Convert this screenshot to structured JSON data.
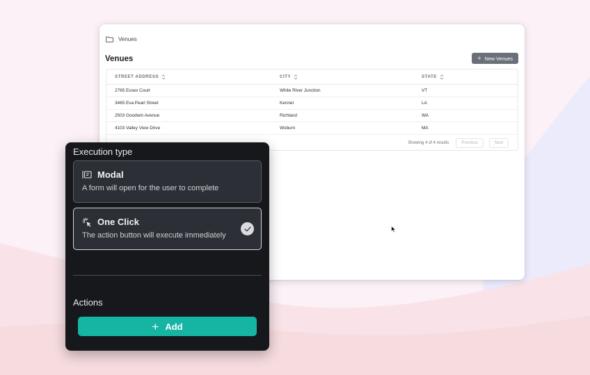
{
  "breadcrumb": {
    "label": "Venues",
    "icon": "folder-icon"
  },
  "page": {
    "title": "Venues",
    "new_button_label": "New Venues"
  },
  "table": {
    "columns": [
      "STREET ADDRESS",
      "CITY",
      "STATE"
    ],
    "rows": [
      {
        "street": "2765 Essex Court",
        "city": "White River Junction",
        "state": "VT"
      },
      {
        "street": "3465 Eva Pearl Street",
        "city": "Kenner",
        "state": "LA"
      },
      {
        "street": "2503 Goodwin Avenue",
        "city": "Richland",
        "state": "WA"
      },
      {
        "street": "4103 Valley View Drive",
        "city": "Woburn",
        "state": "MA"
      }
    ],
    "showing_text": "Showing 4 of 4 results",
    "previous_label": "Previous",
    "next_label": "Next"
  },
  "panel": {
    "execution_type_label": "Execution type",
    "options": [
      {
        "title": "Modal",
        "description": "A form will open for the user to complete",
        "icon": "modal-icon",
        "selected": false
      },
      {
        "title": "One Click",
        "description": "The action button will execute immediately",
        "icon": "cursor-click-icon",
        "selected": true
      }
    ],
    "actions_label": "Actions",
    "add_button_label": "Add"
  },
  "colors": {
    "accent": "#16b4a3",
    "panel_bg": "#17181b",
    "new_button_bg": "#6b6f78",
    "page_bg": "#fbf1f6"
  }
}
